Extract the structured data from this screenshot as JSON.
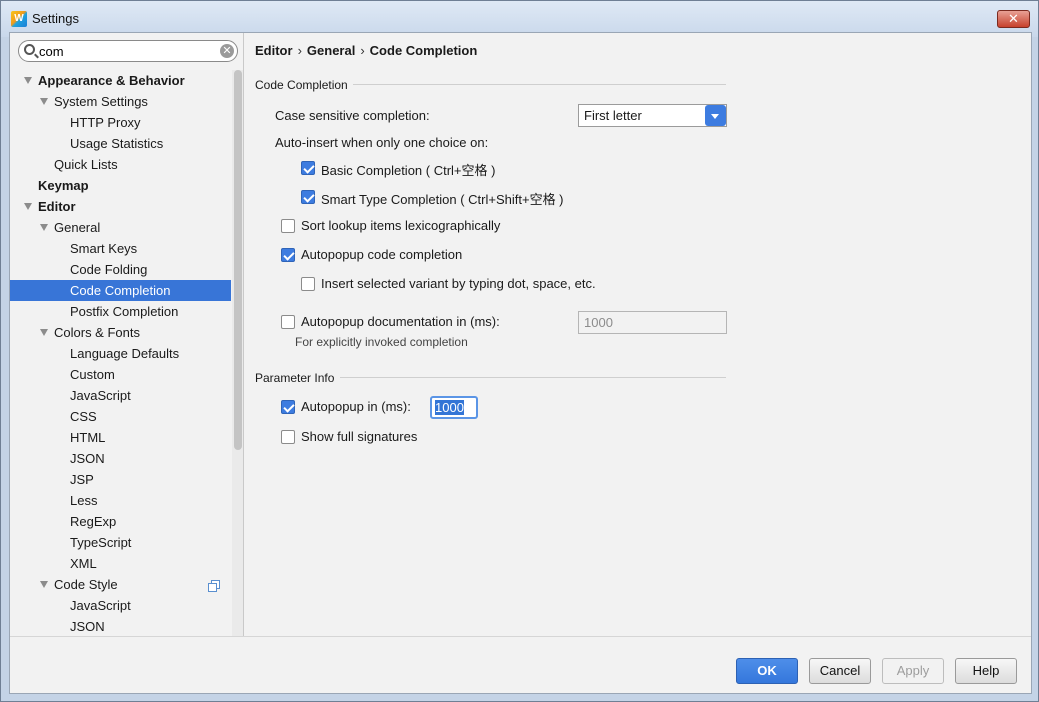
{
  "window": {
    "title": "Settings",
    "close_label": "✕"
  },
  "search": {
    "value": "com",
    "clear_label": "✕"
  },
  "tree": {
    "appearance_behavior": "Appearance & Behavior",
    "system_settings": "System Settings",
    "http_proxy": "HTTP Proxy",
    "usage_statistics": "Usage Statistics",
    "quick_lists": "Quick Lists",
    "keymap": "Keymap",
    "editor": "Editor",
    "general": "General",
    "smart_keys": "Smart Keys",
    "code_folding": "Code Folding",
    "code_completion": "Code Completion",
    "postfix_completion": "Postfix Completion",
    "colors_fonts": "Colors & Fonts",
    "language_defaults": "Language Defaults",
    "custom": "Custom",
    "javascript": "JavaScript",
    "css": "CSS",
    "html": "HTML",
    "json": "JSON",
    "jsp": "JSP",
    "less": "Less",
    "regexp": "RegExp",
    "typescript": "TypeScript",
    "xml": "XML",
    "code_style": "Code Style",
    "cs_javascript": "JavaScript",
    "cs_json": "JSON"
  },
  "breadcrumb": {
    "part1": "Editor",
    "part2": "General",
    "part3": "Code Completion",
    "separator": "›"
  },
  "code_completion": {
    "section_title": "Code Completion",
    "case_sensitive_label": "Case sensitive completion:",
    "case_sensitive_value": "First letter",
    "auto_insert_label": "Auto-insert when only one choice on:",
    "basic_completion_label": "Basic Completion ( Ctrl+空格 )",
    "basic_completion_checked": true,
    "smart_type_label": "Smart Type Completion ( Ctrl+Shift+空格 )",
    "smart_type_checked": true,
    "sort_lexico_label": "Sort lookup items lexicographically",
    "sort_lexico_checked": false,
    "autopopup_code_label": "Autopopup code completion",
    "autopopup_code_checked": true,
    "insert_variant_label": "Insert selected variant by typing dot, space, etc.",
    "insert_variant_checked": false,
    "autopopup_doc_label": "Autopopup documentation in (ms):",
    "autopopup_doc_checked": false,
    "autopopup_doc_value": "1000",
    "autopopup_doc_hint": "For explicitly invoked completion"
  },
  "parameter_info": {
    "section_title": "Parameter Info",
    "autopopup_label": "Autopopup in (ms):",
    "autopopup_checked": true,
    "autopopup_value": "1000",
    "show_full_label": "Show full signatures",
    "show_full_checked": false
  },
  "footer": {
    "ok": "OK",
    "cancel": "Cancel",
    "apply": "Apply",
    "help": "Help"
  },
  "colors": {
    "selection": "#3875d7",
    "primary_button": "#3477dc",
    "titlebar": "#c9d8eb"
  }
}
